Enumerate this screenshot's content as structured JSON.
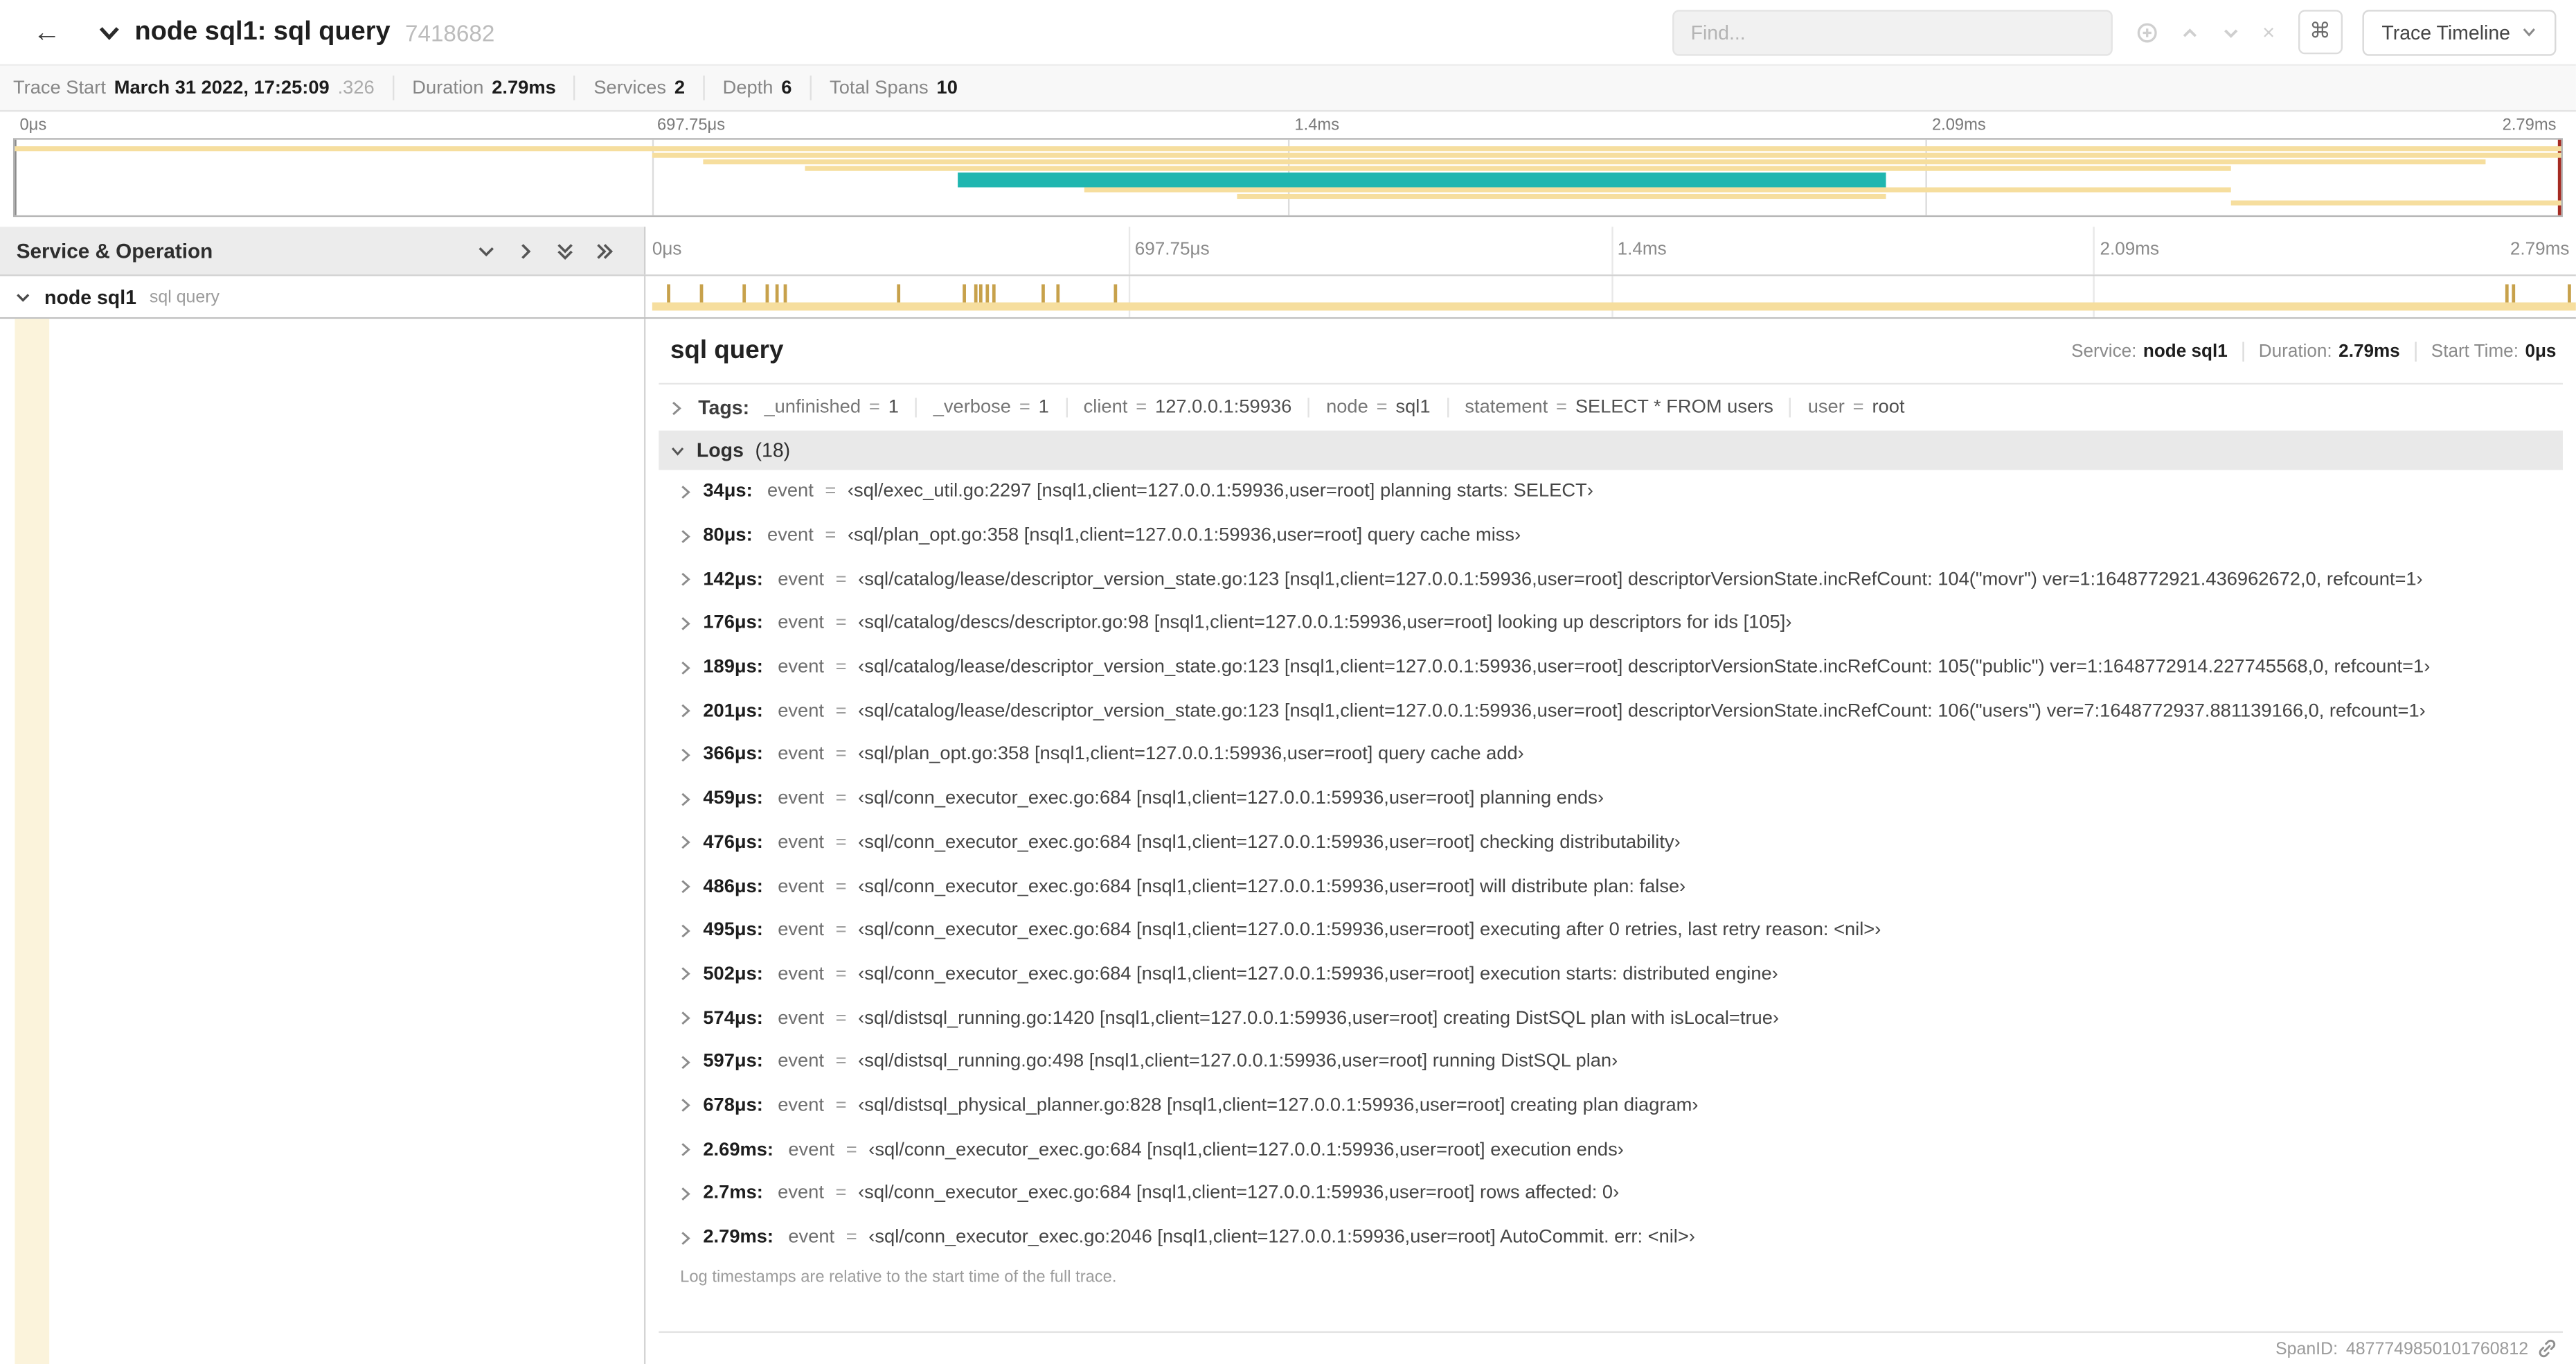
{
  "header": {
    "back": "←",
    "title": "node sql1: sql query",
    "trace_id": "7418682",
    "find_placeholder": "Find...",
    "clear": "×",
    "cmd": "⌘",
    "view_dropdown": "Trace Timeline"
  },
  "summary": {
    "items": [
      {
        "label": "Trace Start",
        "value": "March 31 2022, 17:25:09",
        "muted": ".326"
      },
      {
        "label": "Duration",
        "value": "2.79ms",
        "muted": ""
      },
      {
        "label": "Services",
        "value": "2",
        "muted": ""
      },
      {
        "label": "Depth",
        "value": "6",
        "muted": ""
      },
      {
        "label": "Total Spans",
        "value": "10",
        "muted": ""
      }
    ]
  },
  "minimap": {
    "labels": [
      "0μs",
      "697.75μs",
      "1.4ms",
      "2.09ms",
      "2.79ms"
    ],
    "colors": {
      "span": "#F6DE9E",
      "highlight": "#1FB6B0",
      "tick": "#C7A14B",
      "handle": "#A52A22"
    },
    "bars": [
      {
        "row": 0,
        "start": 0,
        "end": 100,
        "color": "#F6DE9E",
        "h": 1
      },
      {
        "row": 1,
        "start": 25,
        "end": 100,
        "color": "#F6DE9E",
        "h": 1
      },
      {
        "row": 2,
        "start": 27,
        "end": 97,
        "color": "#F6DE9E",
        "h": 1
      },
      {
        "row": 3,
        "start": 31,
        "end": 87,
        "color": "#F6DE9E",
        "h": 1
      },
      {
        "row": 4,
        "start": 37,
        "end": 73.5,
        "color": "#1FB6B0",
        "h": 2
      },
      {
        "row": 6,
        "start": 42,
        "end": 87,
        "color": "#F6DE9E",
        "h": 1
      },
      {
        "row": 7,
        "start": 48,
        "end": 73.5,
        "color": "#F6DE9E",
        "h": 1
      },
      {
        "row": 8,
        "start": 87,
        "end": 100,
        "color": "#F6DE9E",
        "h": 1
      }
    ]
  },
  "timeline": {
    "left_header": "Service & Operation",
    "ruler_labels": [
      "0μs",
      "697.75μs",
      "1.4ms",
      "2.09ms",
      "2.79ms"
    ],
    "span": {
      "service": "node sql1",
      "operation": "sql query",
      "bar_start": 0,
      "bar_end": 100,
      "tick_positions": [
        1.2,
        2.9,
        5.1,
        6.3,
        6.8,
        7.2,
        13.1,
        16.5,
        17.1,
        17.4,
        17.7,
        18.0,
        20.6,
        21.4,
        24.3,
        96.4,
        96.8,
        99.7
      ]
    }
  },
  "detail": {
    "title": "sql query",
    "meta": {
      "service_label": "Service:",
      "service": "node sql1",
      "duration_label": "Duration:",
      "duration": "2.79ms",
      "start_label": "Start Time:",
      "start": "0μs"
    },
    "tags_label": "Tags:",
    "eq": "=",
    "event_key": "event",
    "tags": [
      {
        "key": "_unfinished",
        "value": "1"
      },
      {
        "key": "_verbose",
        "value": "1"
      },
      {
        "key": "client",
        "value": "127.0.0.1:59936"
      },
      {
        "key": "node",
        "value": "sql1"
      },
      {
        "key": "statement",
        "value": "SELECT * FROM users"
      },
      {
        "key": "user",
        "value": "root"
      }
    ],
    "logs_label": "Logs",
    "logs_count": "(18)",
    "logs": [
      {
        "time": "34μs:",
        "event": "‹sql/exec_util.go:2297 [nsql1,client=127.0.0.1:59936,user=root] planning starts: SELECT›"
      },
      {
        "time": "80μs:",
        "event": "‹sql/plan_opt.go:358 [nsql1,client=127.0.0.1:59936,user=root] query cache miss›"
      },
      {
        "time": "142μs:",
        "event": "‹sql/catalog/lease/descriptor_version_state.go:123 [nsql1,client=127.0.0.1:59936,user=root] descriptorVersionState.incRefCount: 104(\"movr\") ver=1:1648772921.436962672,0, refcount=1›"
      },
      {
        "time": "176μs:",
        "event": "‹sql/catalog/descs/descriptor.go:98 [nsql1,client=127.0.0.1:59936,user=root] looking up descriptors for ids [105]›"
      },
      {
        "time": "189μs:",
        "event": "‹sql/catalog/lease/descriptor_version_state.go:123 [nsql1,client=127.0.0.1:59936,user=root] descriptorVersionState.incRefCount: 105(\"public\") ver=1:1648772914.227745568,0, refcount=1›"
      },
      {
        "time": "201μs:",
        "event": "‹sql/catalog/lease/descriptor_version_state.go:123 [nsql1,client=127.0.0.1:59936,user=root] descriptorVersionState.incRefCount: 106(\"users\") ver=7:1648772937.881139166,0, refcount=1›"
      },
      {
        "time": "366μs:",
        "event": "‹sql/plan_opt.go:358 [nsql1,client=127.0.0.1:59936,user=root] query cache add›"
      },
      {
        "time": "459μs:",
        "event": "‹sql/conn_executor_exec.go:684 [nsql1,client=127.0.0.1:59936,user=root] planning ends›"
      },
      {
        "time": "476μs:",
        "event": "‹sql/conn_executor_exec.go:684 [nsql1,client=127.0.0.1:59936,user=root] checking distributability›"
      },
      {
        "time": "486μs:",
        "event": "‹sql/conn_executor_exec.go:684 [nsql1,client=127.0.0.1:59936,user=root] will distribute plan: false›"
      },
      {
        "time": "495μs:",
        "event": "‹sql/conn_executor_exec.go:684 [nsql1,client=127.0.0.1:59936,user=root] executing after 0 retries, last retry reason: <nil>›"
      },
      {
        "time": "502μs:",
        "event": "‹sql/conn_executor_exec.go:684 [nsql1,client=127.0.0.1:59936,user=root] execution starts: distributed engine›"
      },
      {
        "time": "574μs:",
        "event": "‹sql/distsql_running.go:1420 [nsql1,client=127.0.0.1:59936,user=root] creating DistSQL plan with isLocal=true›"
      },
      {
        "time": "597μs:",
        "event": "‹sql/distsql_running.go:498 [nsql1,client=127.0.0.1:59936,user=root] running DistSQL plan›"
      },
      {
        "time": "678μs:",
        "event": "‹sql/distsql_physical_planner.go:828 [nsql1,client=127.0.0.1:59936,user=root] creating plan diagram›"
      },
      {
        "time": "2.69ms:",
        "event": "‹sql/conn_executor_exec.go:684 [nsql1,client=127.0.0.1:59936,user=root] execution ends›"
      },
      {
        "time": "2.7ms:",
        "event": "‹sql/conn_executor_exec.go:684 [nsql1,client=127.0.0.1:59936,user=root] rows affected: 0›"
      },
      {
        "time": "2.79ms:",
        "event": "‹sql/conn_executor_exec.go:2046 [nsql1,client=127.0.0.1:59936,user=root] AutoCommit. err: <nil>›"
      }
    ],
    "footnote": "Log timestamps are relative to the start time of the full trace.",
    "span_id_label": "SpanID:",
    "span_id": "4877749850101760812"
  }
}
